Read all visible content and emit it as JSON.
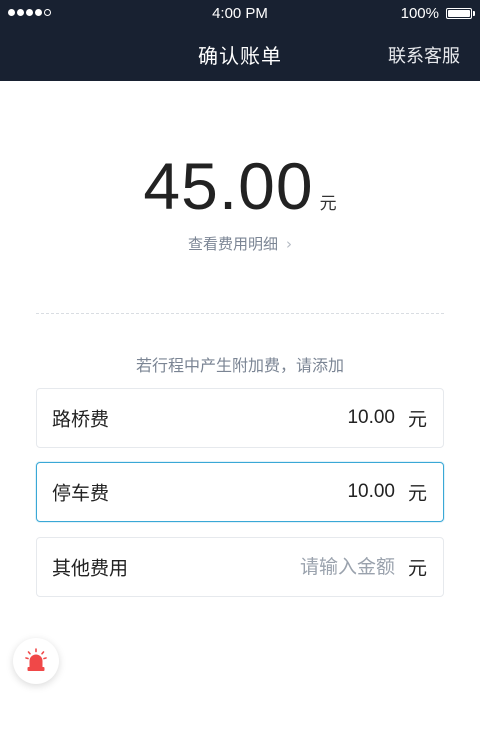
{
  "status_bar": {
    "signal_dots_filled": 4,
    "signal_dots_total": 5,
    "time": "4:00 PM",
    "battery_percent": "100%"
  },
  "nav": {
    "title": "确认账单",
    "right_action": "联系客服"
  },
  "bill": {
    "amount": "45.00",
    "unit": "元",
    "detail_link": "查看费用明细"
  },
  "extra_fees": {
    "hint": "若行程中产生附加费，请添加",
    "items": [
      {
        "label": "路桥费",
        "value": "10.00",
        "unit": "元",
        "placeholder": "",
        "active": false
      },
      {
        "label": "停车费",
        "value": "10.00",
        "unit": "元",
        "placeholder": "",
        "active": true
      },
      {
        "label": "其他费用",
        "value": "",
        "unit": "元",
        "placeholder": "请输入金额",
        "active": false
      }
    ]
  },
  "colors": {
    "header_bg": "#182131",
    "active_border": "#3aa8d6",
    "alarm_red": "#f04848"
  },
  "icons": {
    "sos": "alarm-siren-icon",
    "detail_chevron": "chevron-right-icon"
  }
}
